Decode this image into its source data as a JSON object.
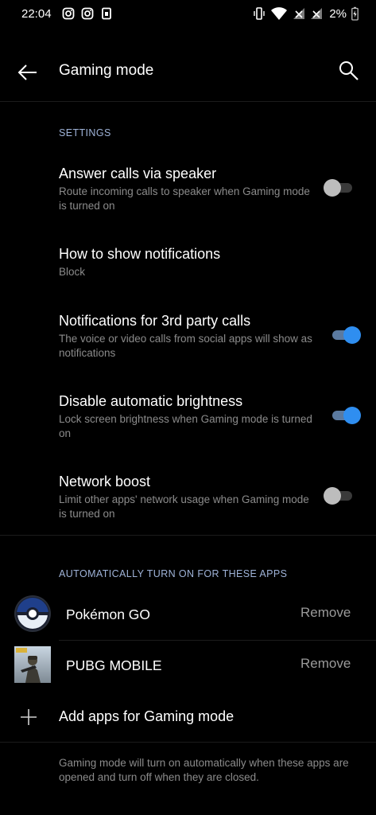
{
  "status_bar": {
    "time": "22:04",
    "battery_text": "2%"
  },
  "header": {
    "title": "Gaming mode"
  },
  "sections": {
    "settings_header": "SETTINGS",
    "apps_header": "AUTOMATICALLY TURN ON FOR THESE APPS"
  },
  "settings": [
    {
      "title": "Answer calls via speaker",
      "subtitle": "Route incoming calls to speaker when Gaming mode is turned on",
      "toggle": "off"
    },
    {
      "title": "How to show notifications",
      "subtitle": "Block"
    },
    {
      "title": "Notifications for 3rd party calls",
      "subtitle": "The voice or video calls from social apps will show as notifications",
      "toggle": "on"
    },
    {
      "title": "Disable automatic brightness",
      "subtitle": "Lock screen brightness when Gaming mode is turned on",
      "toggle": "on"
    },
    {
      "title": "Network boost",
      "subtitle": "Limit other apps' network usage when Gaming mode is turned on",
      "toggle": "off"
    }
  ],
  "apps": [
    {
      "name": "Pokémon GO",
      "action": "Remove"
    },
    {
      "name": "PUBG MOBILE",
      "action": "Remove"
    }
  ],
  "add_apps_label": "Add apps for Gaming mode",
  "footer_note": "Gaming mode will turn on automatically when these apps are opened and turn off when they are closed.",
  "colors": {
    "background": "#000000",
    "accent": "#2f8ef0",
    "section_header": "#9fb3d8",
    "secondary_text": "#8b8b8b"
  }
}
